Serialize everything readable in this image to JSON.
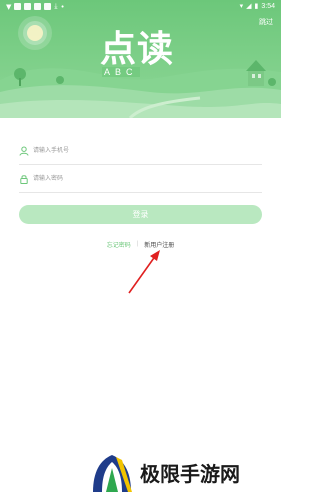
{
  "status_bar": {
    "time": "3:54"
  },
  "header": {
    "skip_label": "跳过",
    "logo_main": "点读",
    "logo_sub": "ABC"
  },
  "form": {
    "phone_placeholder": "请输入手机号",
    "password_placeholder": "请输入密码",
    "login_label": "登录"
  },
  "links": {
    "forgot_password": "忘记密码",
    "separator": "|",
    "register": "新用户注册"
  },
  "watermark": {
    "text": "极限手游网"
  },
  "colors": {
    "brand_green": "#6cc77a",
    "button_disabled": "#b9e8c0",
    "arrow_red": "#e02020"
  }
}
